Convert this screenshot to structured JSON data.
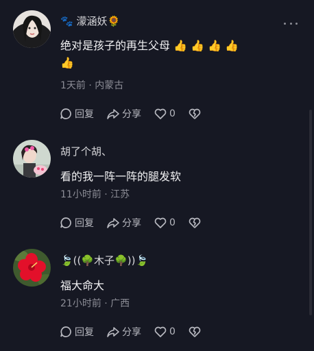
{
  "comments": [
    {
      "name": "🐾 濛涵妖🌻",
      "text_line1": "绝对是孩子的再生父母 👍 👍 👍 👍",
      "text_line2": "👍",
      "meta": "1天前 · 内蒙古",
      "reply_label": "回复",
      "share_label": "分享",
      "like_count": "0"
    },
    {
      "name": "胡了个胡、",
      "text_line1": "看的我一阵一阵的腿发软",
      "meta": "11小时前 · 江苏",
      "reply_label": "回复",
      "share_label": "分享",
      "like_count": "0"
    },
    {
      "name": "🍃((🌳木子🌳))🍃",
      "text_line1": "福大命大",
      "meta": "21小时前 · 广西",
      "reply_label": "回复",
      "share_label": "分享",
      "like_count": "0"
    }
  ],
  "colors": {
    "background": "#161823",
    "meta": "#8c8d96",
    "text": "#f0f0f2"
  }
}
